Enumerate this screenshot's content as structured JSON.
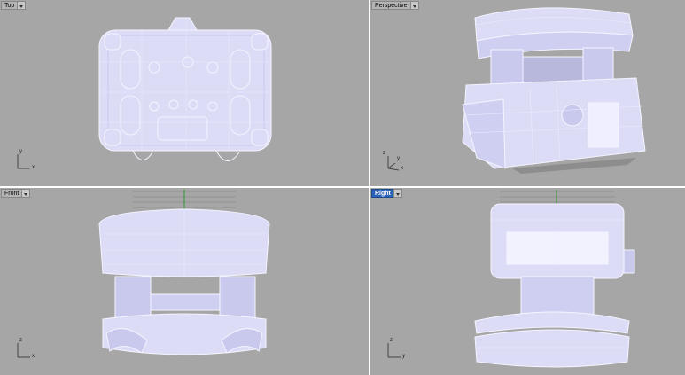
{
  "viewports": [
    {
      "id": "top",
      "title": "Top",
      "active": false,
      "axes": [
        "y",
        "x"
      ]
    },
    {
      "id": "perspective",
      "title": "Perspective",
      "active": false,
      "axes": [
        "z",
        "y",
        "x"
      ]
    },
    {
      "id": "front",
      "title": "Front",
      "active": false,
      "axes": [
        "z",
        "x"
      ]
    },
    {
      "id": "right",
      "title": "Right",
      "active": true,
      "axes": [
        "z",
        "y"
      ]
    }
  ],
  "colors": {
    "viewport_bg": "#a6a6a6",
    "model_fill": "#d9d9f7",
    "model_stroke": "#ffffff",
    "grid": "#7a7a7a",
    "active_tab": "#2b63b8"
  }
}
